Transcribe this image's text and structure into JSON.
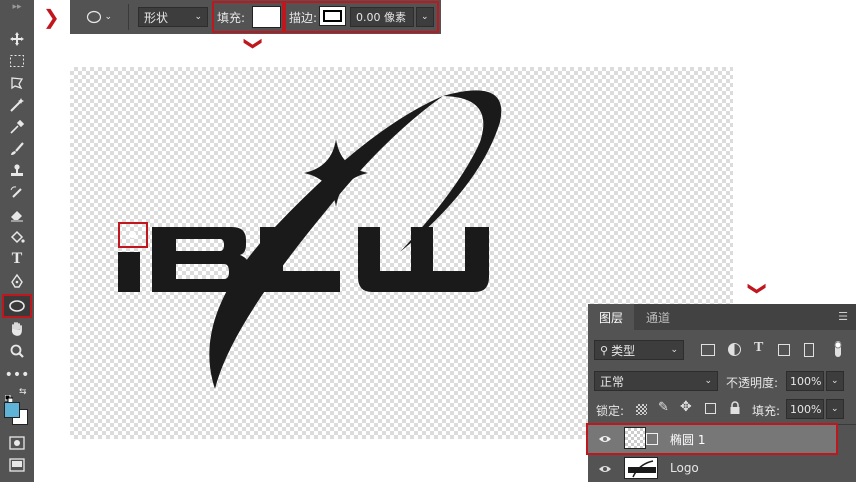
{
  "options_bar": {
    "mode_value": "形状",
    "fill_label": "填充:",
    "stroke_label": "描边:",
    "stroke_width_value": "0.00 像素"
  },
  "canvas": {
    "logo_text": "IBLW"
  },
  "layers_panel": {
    "tab_layers": "图层",
    "tab_channels": "通道",
    "filter_label": "类型",
    "blend_mode": "正常",
    "opacity_label": "不透明度:",
    "opacity_value": "100%",
    "lock_label": "锁定:",
    "fill_label": "填充:",
    "fill_value": "100%",
    "layers": [
      {
        "name": "椭圆 1",
        "selected": true
      },
      {
        "name": "Logo",
        "selected": false
      }
    ]
  },
  "colors": {
    "ui_panel": "#535353",
    "highlight_red": "#c0171f",
    "logo": "#1a1a1a",
    "foreground_swatch": "#5fb3d6",
    "selected_layer": "#777777"
  }
}
